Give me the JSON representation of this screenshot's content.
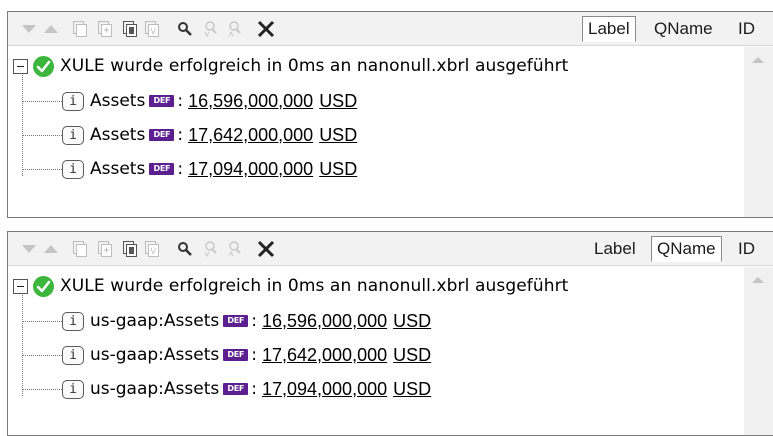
{
  "toolbar": {
    "icons": [
      "expand-down-icon",
      "collapse-up-icon",
      "copy-icon",
      "copy-all-icon",
      "paste-icon",
      "copy-value-icon",
      "find-icon",
      "find-prev-icon",
      "find-next-icon",
      "clear-icon"
    ]
  },
  "panels": [
    {
      "tabs": {
        "label": "Label",
        "qname": "QName",
        "id": "ID",
        "active": "Label"
      },
      "message": "XULE wurde erfolgreich in 0ms an nanonull.xbrl ausgeführt",
      "items": [
        {
          "info": "i",
          "concept": "Assets",
          "badge": "DEF",
          "colon": ":",
          "value": "16,596,000,000",
          "unit": "USD"
        },
        {
          "info": "i",
          "concept": "Assets",
          "badge": "DEF",
          "colon": ":",
          "value": "17,642,000,000",
          "unit": "USD"
        },
        {
          "info": "i",
          "concept": "Assets",
          "badge": "DEF",
          "colon": ":",
          "value": "17,094,000,000",
          "unit": "USD"
        }
      ]
    },
    {
      "tabs": {
        "label": "Label",
        "qname": "QName",
        "id": "ID",
        "active": "QName"
      },
      "message": "XULE wurde erfolgreich in 0ms an nanonull.xbrl ausgeführt",
      "items": [
        {
          "info": "i",
          "concept": "us-gaap:Assets",
          "badge": "DEF",
          "colon": ":",
          "value": "16,596,000,000",
          "unit": "USD"
        },
        {
          "info": "i",
          "concept": "us-gaap:Assets",
          "badge": "DEF",
          "colon": ":",
          "value": "17,642,000,000",
          "unit": "USD"
        },
        {
          "info": "i",
          "concept": "us-gaap:Assets",
          "badge": "DEF",
          "colon": ":",
          "value": "17,094,000,000",
          "unit": "USD"
        }
      ]
    }
  ],
  "colors": {
    "success": "#3cb63c",
    "def_badge": "#5b1f8f",
    "toolbar_bg": "#f2f2f2"
  }
}
